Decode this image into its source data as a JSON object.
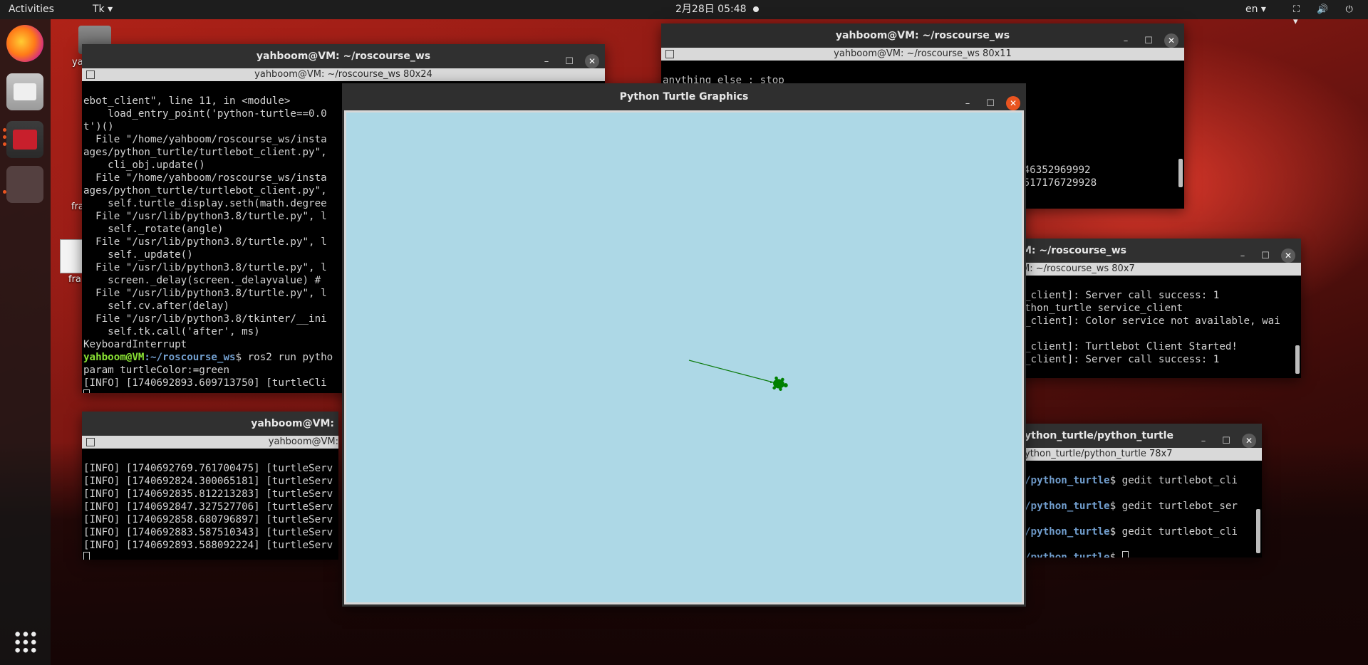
{
  "topbar": {
    "activities": "Activities",
    "app_menu": "Tk ▾",
    "clock": "2月28日  05:48",
    "lang": "en ▾",
    "status_icons": "⛶ 🔊 ⏻ ▾"
  },
  "desktop": {
    "folder_label": "ya",
    "file_label_1": "fra",
    "file_label_2": "fra"
  },
  "turtle_window": {
    "title": "Python Turtle Graphics",
    "canvas_bg": "#add8e6",
    "path_color": "#0b7a0b",
    "turtle_color": "#008000"
  },
  "terminal_main": {
    "title": "yahboom@VM: ~/roscourse_ws",
    "subtitle": "yahboom@VM: ~/roscourse_ws 80x24",
    "lines": [
      "ebot_client\", line 11, in <module>",
      "    load_entry_point('python-turtle==0.0",
      "t')()",
      "  File \"/home/yahboom/roscourse_ws/insta",
      "ages/python_turtle/turtlebot_client.py\",",
      "    cli_obj.update()",
      "  File \"/home/yahboom/roscourse_ws/insta",
      "ages/python_turtle/turtlebot_client.py\",",
      "    self.turtle_display.seth(math.degree",
      "  File \"/usr/lib/python3.8/turtle.py\", l",
      "    self._rotate(angle)",
      "  File \"/usr/lib/python3.8/turtle.py\", l",
      "    self._update()",
      "  File \"/usr/lib/python3.8/turtle.py\", l",
      "    screen._delay(screen._delayvalue) #",
      "  File \"/usr/lib/python3.8/turtle.py\", l",
      "    self.cv.after(delay)",
      "  File \"/usr/lib/python3.8/tkinter/__ini",
      "    self.tk.call('after', ms)",
      "KeyboardInterrupt"
    ],
    "prompt_user": "yahboom@VM",
    "prompt_path": ":~/roscourse_ws",
    "prompt_cmd": "$ ros2 run pytho",
    "line_param": "param turtleColor:=green",
    "line_info": "[INFO] [1740692893.609713750] [turtleCli"
  },
  "terminal_top_right": {
    "title": "yahboom@VM: ~/roscourse_ws",
    "subtitle": "yahboom@VM: ~/roscourse_ws 80x11",
    "line_stop": "anything else : stop",
    "line_num1": "00946352969992",
    "line_num2": "508517176729928"
  },
  "terminal_mid_right": {
    "title": "M: ~/roscourse_ws",
    "subtitle": "M: ~/roscourse_ws 80x7",
    "lines": [
      "_client]: Server call success: 1",
      "thon_turtle service_client",
      "_client]: Color service not available, wai",
      "",
      "_client]: Turtlebot Client Started!",
      "_client]: Server call success: 1"
    ]
  },
  "terminal_bottom_right": {
    "title": "ython_turtle/python_turtle",
    "subtitle": "ython_turtle/python_turtle 78x7",
    "path": "/python_turtle",
    "cmd1": "$ gedit turtlebot_cli",
    "cmd2": "$ gedit turtlebot_ser",
    "cmd3": "$ gedit turtlebot_cli",
    "cmd4": "$ "
  },
  "terminal_bottom_left": {
    "title": "yahboom@VM:",
    "subtitle": "yahboom@VM: ",
    "lines": [
      "[INFO] [1740692769.761700475] [turtleServ",
      "[INFO] [1740692824.300065181] [turtleServ",
      "[INFO] [1740692835.812213283] [turtleServ",
      "[INFO] [1740692847.327527706] [turtleServ",
      "[INFO] [1740692858.680796897] [turtleServ",
      "[INFO] [1740692883.587510343] [turtleServ",
      "[INFO] [1740692893.588092224] [turtleServ"
    ]
  },
  "window_controls": {
    "minimize": "–",
    "maximize": "☐",
    "close": "✕"
  }
}
